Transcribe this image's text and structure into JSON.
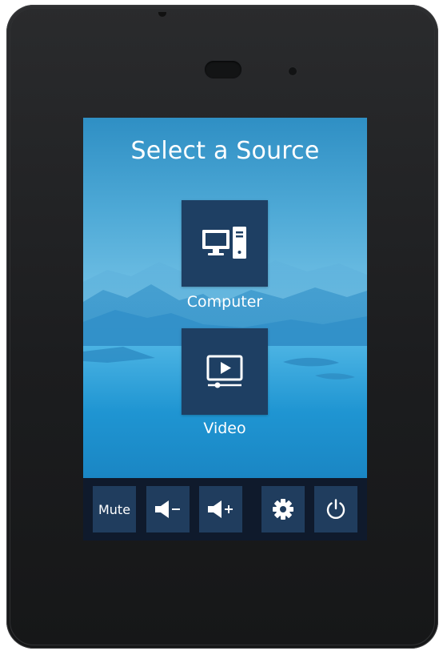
{
  "screen": {
    "title": "Select a Source"
  },
  "sources": [
    {
      "label": "Computer",
      "icon": "computer-icon"
    },
    {
      "label": "Video",
      "icon": "video-play-icon"
    }
  ],
  "controls": {
    "mute_label": "Mute",
    "volume_down_icon": "volume-down-icon",
    "volume_up_icon": "volume-up-icon",
    "settings_icon": "gear-icon",
    "power_icon": "power-icon"
  },
  "colors": {
    "tile": "#1e3f63",
    "control_bar": "#0f1a2c",
    "control_button": "#203d5e",
    "device_body": "#1c1d1f"
  }
}
